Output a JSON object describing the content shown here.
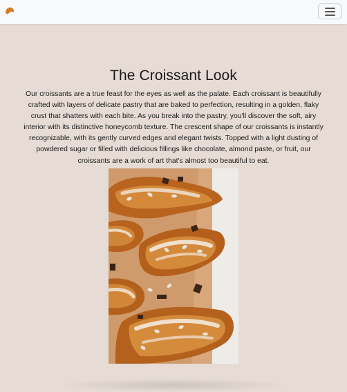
{
  "navbar": {
    "brand_icon": "croissant-icon",
    "menu_icon": "hamburger-menu-icon"
  },
  "main": {
    "title": "The Croissant Look",
    "description": "Our croissants are a true feast for the eyes as well as the palate. Each croissant is beautifully crafted with layers of delicate pastry that are baked to perfection, resulting in a golden, flaky crust that shatters with each bite. As you break into the pastry, you'll discover the soft, airy interior with its distinctive honeycomb texture. The crescent shape of our croissants is instantly recognizable, with its gently curved edges and elegant twists. Topped with a light dusting of powdered sugar or filled with delicious fillings like chocolate, almond paste, or fruit, our croissants are a work of art that's almost too beautiful to eat.",
    "image_subject": "almond-croissants-photo"
  },
  "colors": {
    "page_background": "#e6dbd5",
    "navbar_background": "#f8f9fa",
    "text": "#1a1a1a",
    "croissant_golden": "#c8772e",
    "parchment": "#d9a77a"
  }
}
